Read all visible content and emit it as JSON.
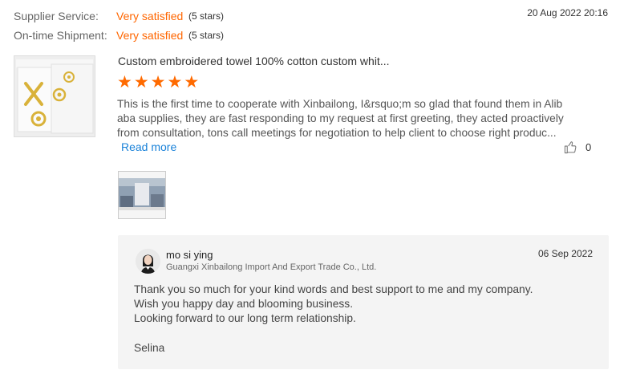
{
  "ratings": [
    {
      "label": "Supplier Service:",
      "value": "Very satisfied",
      "stars": "(5 stars)"
    },
    {
      "label": "On-time Shipment:",
      "value": "Very satisfied",
      "stars": "(5 stars)"
    }
  ],
  "review": {
    "date": "20 Aug 2022 20:16",
    "product_title": "Custom embroidered towel 100% cotton custom whit...",
    "rating": 5,
    "text_lines": [
      "This is the first time to cooperate with Xinbailong, I&rsquo;m so glad that found them in Alib",
      "aba supplies, they are fast responding to my request at first greeting, they acted proactively",
      "from consultation, tons call meetings for negotiation to help client to choose right produc..."
    ],
    "read_more": "Read more",
    "like_count": "0"
  },
  "reply": {
    "name": "mo si ying",
    "company": "Guangxi Xinbailong Import And Export Trade Co., Ltd.",
    "date": "06 Sep 2022",
    "lines": [
      "Thank you so much for your kind words and best support to me and my company.",
      "Wish you happy day and blooming business.",
      "Looking forward to our long term relationship."
    ],
    "signature": "Selina"
  },
  "colors": {
    "accent": "#ff6600",
    "star": "#ff6a00",
    "link": "#1a82d9",
    "reply_bg": "#f4f4f4"
  },
  "icons": {
    "star": "star-icon",
    "like": "thumbs-up-icon"
  }
}
